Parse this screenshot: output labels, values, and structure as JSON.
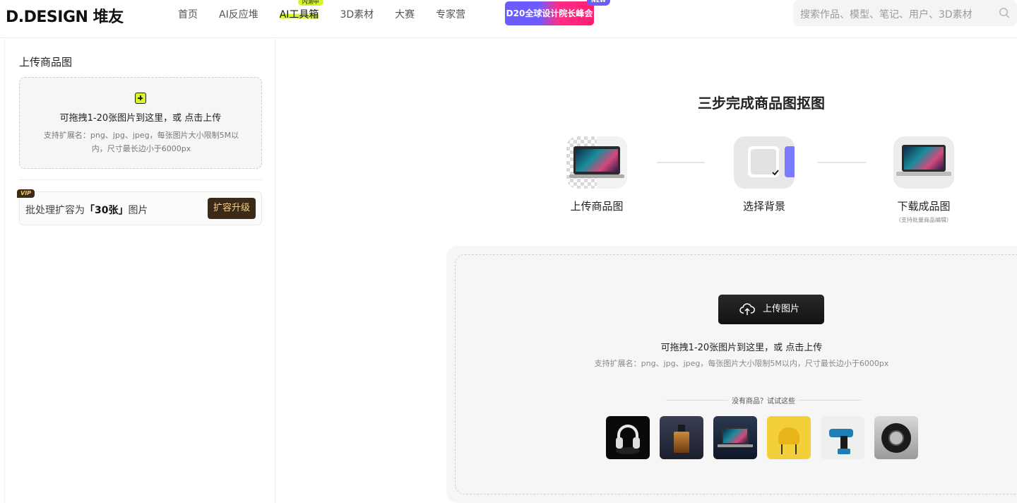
{
  "header": {
    "logo": "D.DESIGN 堆友",
    "nav": [
      {
        "label": "首页"
      },
      {
        "label": "AI反应堆"
      },
      {
        "label": "AI工具箱",
        "highlight": true,
        "badge": "内测中"
      },
      {
        "label": "3D素材"
      },
      {
        "label": "大赛"
      },
      {
        "label": "专家营"
      }
    ],
    "promo": {
      "label": "D20全球设计院长峰会",
      "badge": "NEW"
    },
    "search": {
      "placeholder": "搜索作品、模型、笔记、用户、3D素材"
    }
  },
  "sidebar": {
    "title": "上传商品图",
    "drop_main": "可拖拽1-20张图片到这里，或 点击上传",
    "drop_sub": "支持扩展名：png、jpg、jpeg，每张图片大小限制5M以内，尺寸最长边小于6000px",
    "vip_tag": "VIP",
    "vip_text_before": "批处理扩容为",
    "vip_text_bold": "「30张」",
    "vip_text_after": "图片",
    "upgrade_label": "扩容升级"
  },
  "main": {
    "title": "三步完成商品图抠图",
    "steps": [
      {
        "label": "上传商品图",
        "note": ""
      },
      {
        "label": "选择背景",
        "note": ""
      },
      {
        "label": "下载成品图",
        "note": "（支持批量商品编辑）"
      }
    ],
    "upload_button": "上传图片",
    "upload_main": "可拖拽1-20张图片到这里，或 点击上传",
    "upload_sub": "支持扩展名：png、jpg、jpeg，每张图片大小限制5M以内，尺寸最长边小于6000px",
    "try_text": "没有商品？试试这些",
    "samples": [
      {
        "name": "headphones"
      },
      {
        "name": "perfume"
      },
      {
        "name": "laptop"
      },
      {
        "name": "chair"
      },
      {
        "name": "drill"
      },
      {
        "name": "tire"
      }
    ]
  },
  "colors": {
    "accent": "#d8f52c",
    "promo_start": "#6b5cff",
    "promo_end": "#ff1f73",
    "dark_button": "#111111",
    "vip_brown": "#3b2a18"
  }
}
